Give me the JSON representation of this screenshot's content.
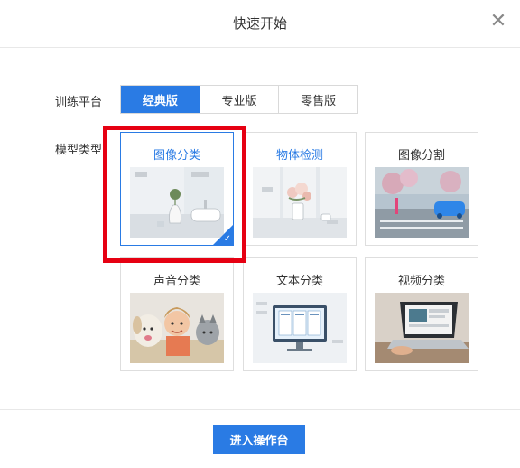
{
  "dialog": {
    "title": "快速开始",
    "close_glyph": "✕"
  },
  "platform": {
    "label": "训练平台",
    "options": [
      {
        "label": "经典版",
        "active": true
      },
      {
        "label": "专业版",
        "active": false
      },
      {
        "label": "零售版",
        "active": false
      }
    ]
  },
  "model": {
    "label": "模型类型",
    "cards": [
      {
        "title": "图像分类",
        "selected": true,
        "icon": "vase-sink-photo"
      },
      {
        "title": "物体检测",
        "selected": false,
        "icon": "flower-vase-photo"
      },
      {
        "title": "图像分割",
        "selected": false,
        "icon": "street-car-photo"
      },
      {
        "title": "声音分类",
        "selected": false,
        "icon": "dog-child-cat-photo"
      },
      {
        "title": "文本分类",
        "selected": false,
        "icon": "document-monitor-photo"
      },
      {
        "title": "视频分类",
        "selected": false,
        "icon": "laptop-photo"
      }
    ]
  },
  "footer": {
    "primary_label": "进入操作台"
  },
  "colors": {
    "accent": "#2a7be4",
    "highlight": "#e60012"
  }
}
